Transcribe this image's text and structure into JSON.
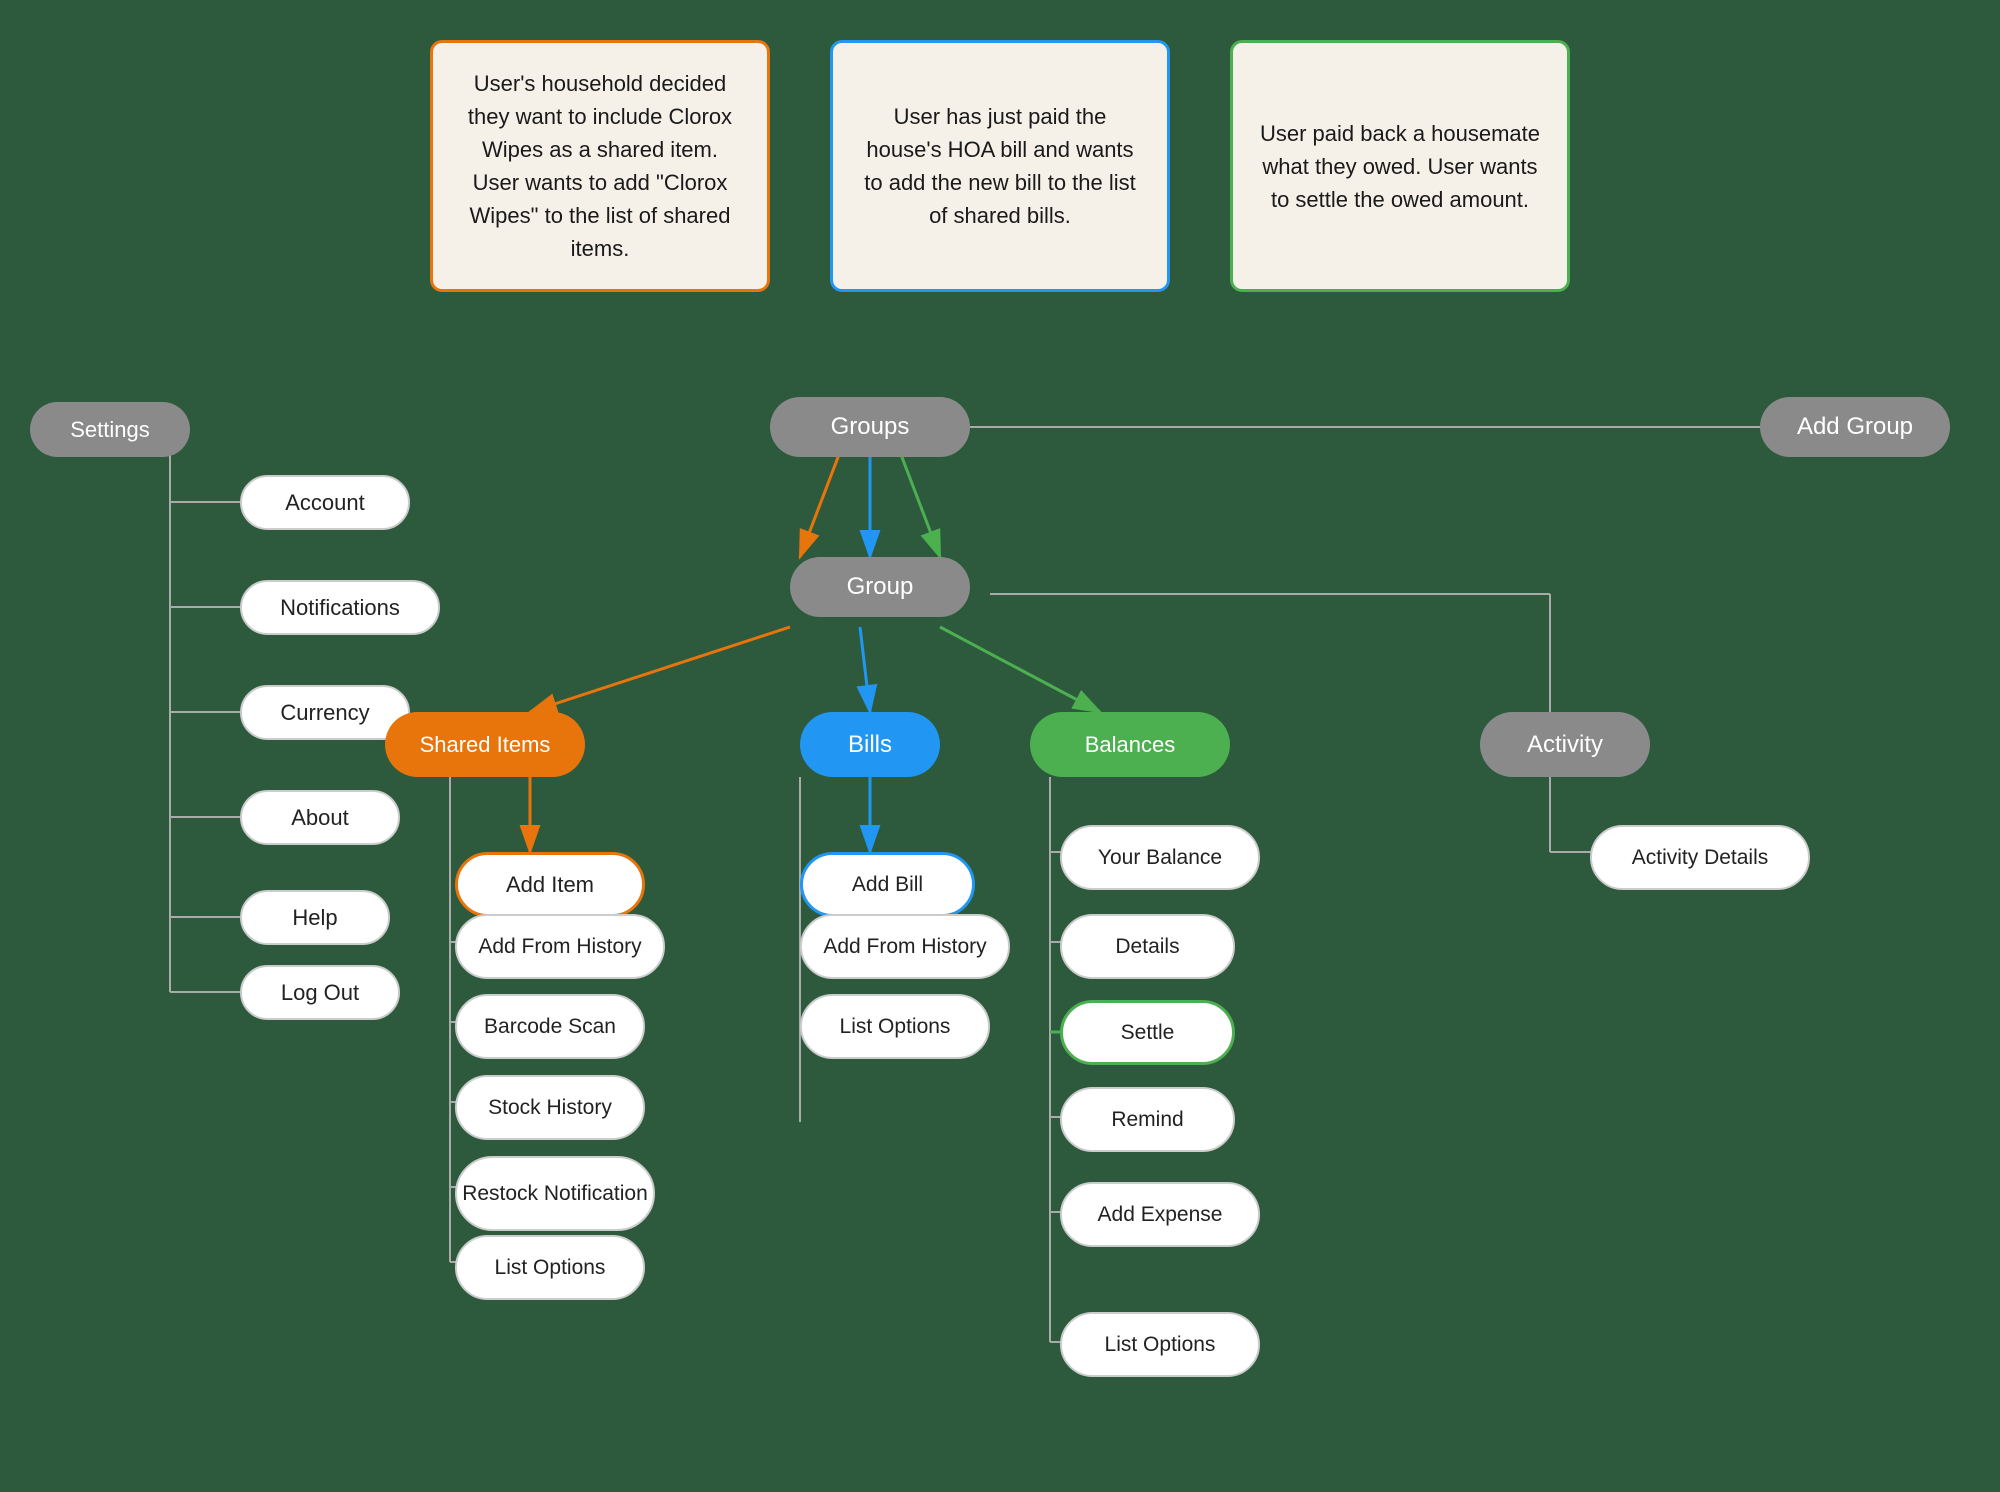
{
  "scenarios": [
    {
      "id": "scenario-orange",
      "color": "orange",
      "text": "User's household decided they want to include Clorox Wipes as a shared item. User wants to add \"Clorox Wipes\" to the list of shared items."
    },
    {
      "id": "scenario-blue",
      "color": "blue",
      "text": "User has just paid the house's HOA bill and wants to add the new bill to the list of shared bills."
    },
    {
      "id": "scenario-green",
      "color": "green",
      "text": "User paid back a housemate what they owed. User wants to settle the owed amount."
    }
  ],
  "nodes": {
    "settings": "Settings",
    "groups": "Groups",
    "add_group": "Add Group",
    "group": "Group",
    "account": "Account",
    "notifications": "Notifications",
    "currency": "Currency",
    "about": "About",
    "help": "Help",
    "log_out": "Log Out",
    "shared_items": "Shared Items",
    "bills": "Bills",
    "balances": "Balances",
    "activity": "Activity",
    "add_item": "Add Item",
    "add_from_history_items": "Add From History",
    "barcode_scan": "Barcode Scan",
    "stock_history": "Stock History",
    "restock_notification": "Restock Notification",
    "list_options_items": "List Options",
    "add_bill": "Add Bill",
    "add_from_history_bills": "Add From History",
    "list_options_bills": "List Options",
    "your_balance": "Your Balance",
    "details": "Details",
    "settle": "Settle",
    "remind": "Remind",
    "add_expense": "Add Expense",
    "list_options_balances": "List Options",
    "activity_details": "Activity Details"
  }
}
